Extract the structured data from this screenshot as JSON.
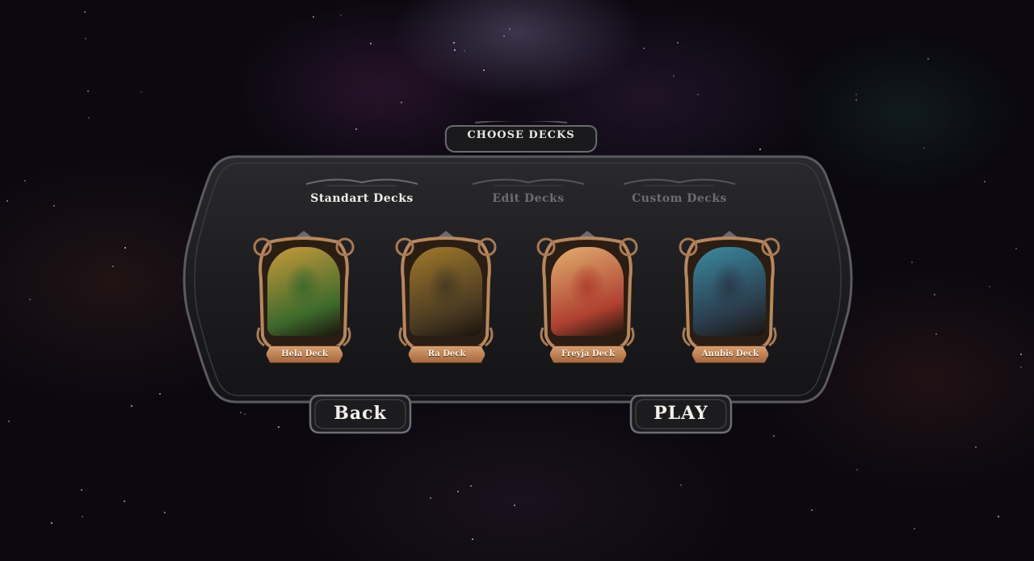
{
  "header": {
    "title": "CHOOSE DECKS"
  },
  "tabs": [
    {
      "label": "Standart Decks",
      "active": true
    },
    {
      "label": "Edit Decks",
      "active": false
    },
    {
      "label": "Custom Decks",
      "active": false
    }
  ],
  "decks": [
    {
      "name": "Hela Deck",
      "art_colors": [
        "#c89a3a",
        "#3d6a2c"
      ]
    },
    {
      "name": "Ra Deck",
      "art_colors": [
        "#a07a2a",
        "#4a3a22"
      ]
    },
    {
      "name": "Freyja Deck",
      "art_colors": [
        "#e0b070",
        "#b04030"
      ]
    },
    {
      "name": "Anubis Deck",
      "art_colors": [
        "#3a8aa0",
        "#2a3a4a"
      ]
    }
  ],
  "buttons": {
    "back_label": "Back",
    "play_label": "PLAY"
  },
  "colors": {
    "panel": "#1e1e22",
    "frame_bronze": "#a87a52",
    "ribbon": "#c48a58"
  }
}
